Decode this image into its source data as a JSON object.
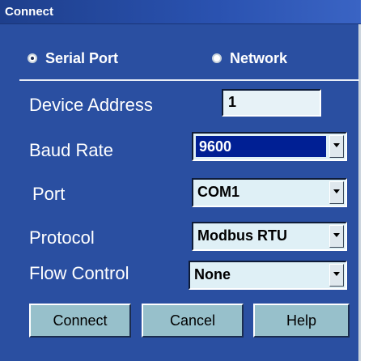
{
  "window": {
    "title": "Connect"
  },
  "connection_type": {
    "options": [
      {
        "label": "Serial Port",
        "selected": true
      },
      {
        "label": "Network",
        "selected": false
      }
    ]
  },
  "form": {
    "device_address": {
      "label": "Device Address",
      "value": "1"
    },
    "baud_rate": {
      "label": "Baud Rate",
      "value": "9600"
    },
    "port": {
      "label": "Port",
      "value": "COM1"
    },
    "protocol": {
      "label": "Protocol",
      "value": "Modbus RTU"
    },
    "flow_control": {
      "label": "Flow Control",
      "value": "None"
    }
  },
  "buttons": {
    "connect": "Connect",
    "cancel": "Cancel",
    "help": "Help"
  },
  "colors": {
    "window_bg": "#2a4fa1",
    "field_bg": "#e7f2f7",
    "button_bg": "#97c0cb",
    "selection": "#001f94"
  }
}
